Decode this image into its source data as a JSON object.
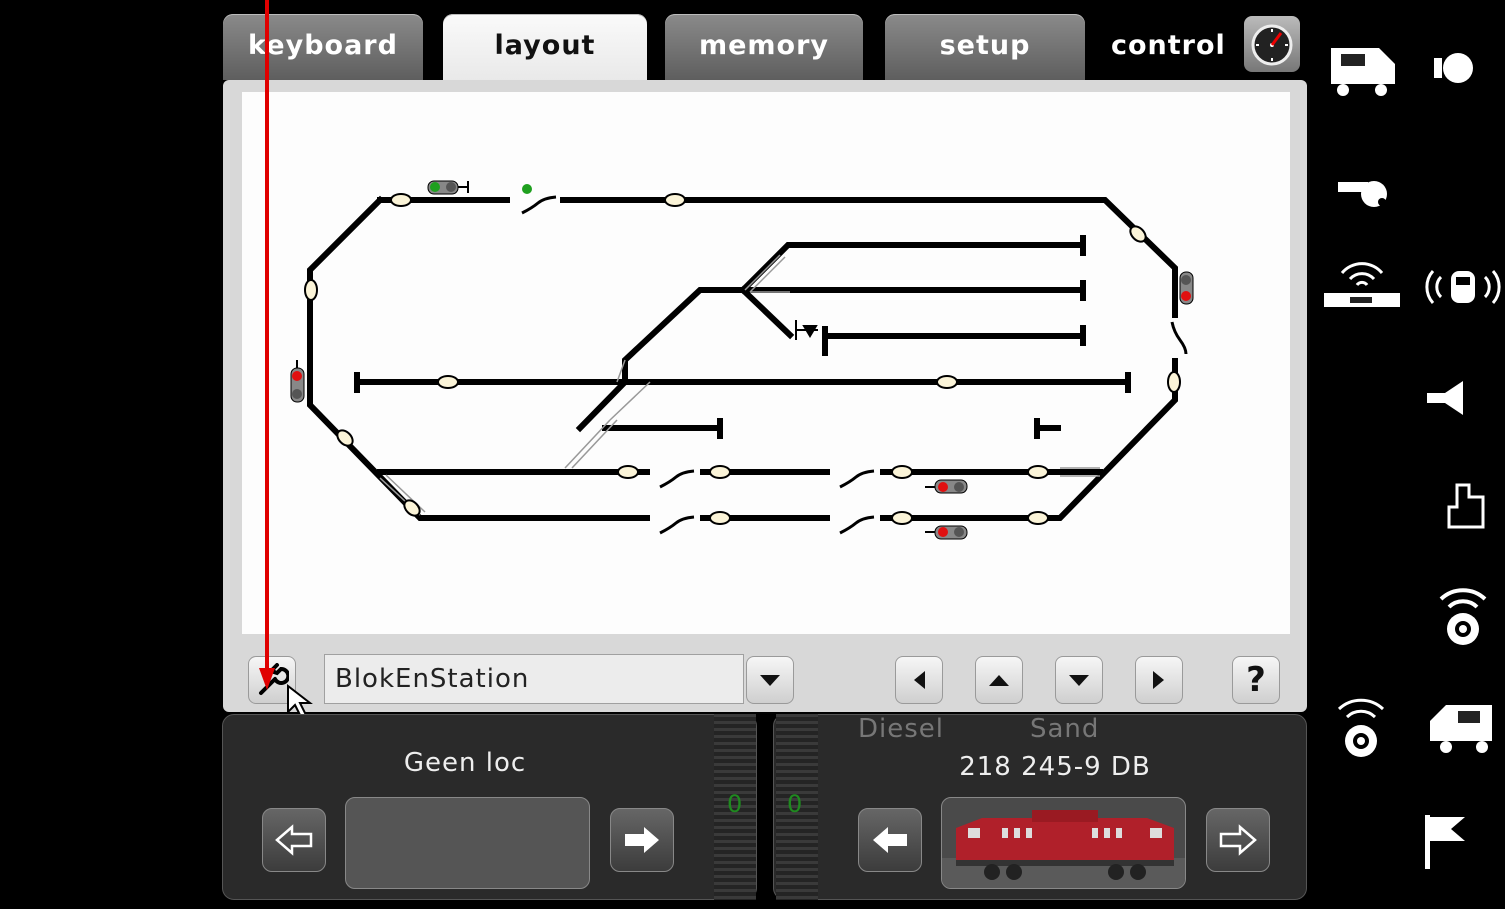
{
  "tabs": [
    {
      "label": "keyboard"
    },
    {
      "label": "layout"
    },
    {
      "label": "memory"
    },
    {
      "label": "setup"
    },
    {
      "label": "control"
    }
  ],
  "layout": {
    "name": "BlokEnStation",
    "help_label": "?"
  },
  "left_loco": {
    "name": "Geen loc",
    "speed": "0"
  },
  "right_loco": {
    "name": "218 245-9 DB",
    "function_1": "Diesel",
    "function_2": "Sand",
    "speed": "0"
  },
  "colors": {
    "signal_red": "#e01010",
    "signal_green": "#1fa01f",
    "annotation_arrow": "#e00000"
  }
}
